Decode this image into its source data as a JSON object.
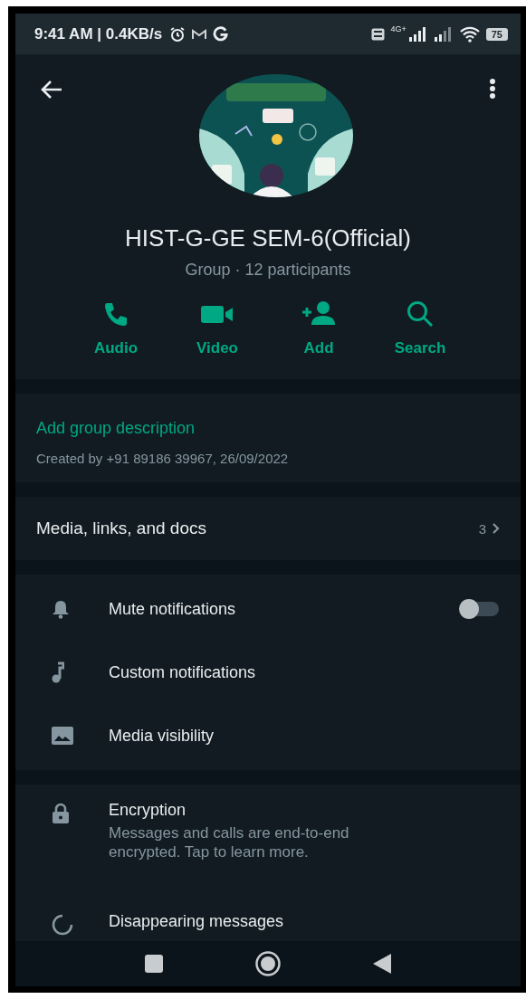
{
  "status_bar": {
    "time": "9:41 AM | 0.4KB/s",
    "network": "4G+",
    "battery": "75"
  },
  "group": {
    "name": "HIST-G-GE SEM-6(Official)",
    "subtitle": "Group · 12 participants"
  },
  "actions": [
    {
      "kind": "phone",
      "label": "Audio"
    },
    {
      "kind": "video",
      "label": "Video"
    },
    {
      "kind": "add",
      "label": "Add"
    },
    {
      "kind": "search",
      "label": "Search"
    }
  ],
  "description": {
    "link": "Add group description",
    "created": "Created by +91 89186 39967, 26/09/2022"
  },
  "media": {
    "label": "Media, links, and docs",
    "count": "3"
  },
  "settings": [
    {
      "kind": "mute",
      "label": "Mute notifications",
      "on": false
    },
    {
      "kind": "tone",
      "label": "Custom notifications"
    },
    {
      "kind": "visibility",
      "label": "Media visibility"
    }
  ],
  "encryption": {
    "title": "Encryption",
    "text": "Messages and calls are end-to-end encrypted. Tap to learn more."
  },
  "next_item": {
    "label": "Disappearing messages"
  }
}
